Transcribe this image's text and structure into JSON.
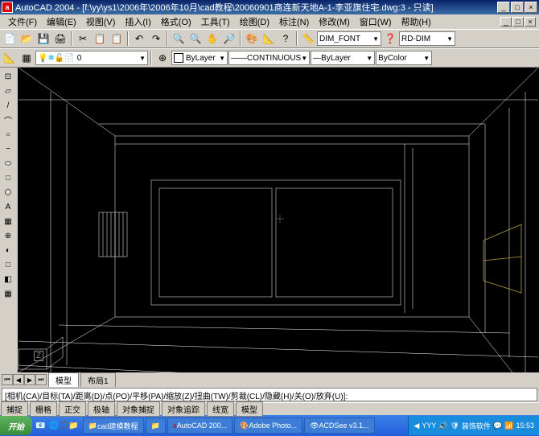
{
  "titlebar": {
    "app_icon_letter": "a",
    "title": "AutoCAD 2004 - [f:\\yy\\ys1\\2006年\\2006年10月\\cad教程\\20060901商连新天地A-1-李亚旗住宅.dwg:3 - 只读]",
    "min": "_",
    "max": "□",
    "close": "×"
  },
  "menubar": {
    "items": [
      "文件(F)",
      "编辑(E)",
      "视图(V)",
      "插入(I)",
      "格式(O)",
      "工具(T)",
      "绘图(D)",
      "标注(N)",
      "修改(M)",
      "窗口(W)",
      "帮助(H)"
    ]
  },
  "toolbar_row1": {
    "icons": [
      "📄",
      "📂",
      "💾",
      "🖨",
      "✂",
      "📋",
      "📋",
      "↶",
      "↷",
      "🔍",
      "🔍",
      "✋",
      "🔎",
      "🎨",
      "📐",
      "?",
      "📏",
      "❓"
    ],
    "dimfont": "DIM_FONT",
    "rddim": "RD-DIM"
  },
  "toolbar_row2": {
    "icons": [
      "📐",
      "▦",
      "⊕",
      "○",
      "◐",
      "⬚",
      "◧",
      "⬛",
      "📋"
    ],
    "layer": "ByLayer",
    "linetype": "CONTINUOUS",
    "lineweight": "ByLayer",
    "color": "ByColor"
  },
  "lefttools": {
    "icons": [
      "⊡",
      "▱",
      "/",
      "⌒",
      "○",
      "~",
      "⬭",
      "□",
      "⬡",
      "A",
      "▦",
      "⊕",
      "◐",
      "□",
      "◧",
      "▦"
    ]
  },
  "viewport": {
    "z_label": "Z"
  },
  "tabs": {
    "active": "模型",
    "inactive": "布局1"
  },
  "command": {
    "text": "[相机(CA)/目标(TA)/距离(D)/点(PO)/平移(PA)/缩放(Z)/扭曲(TW)/剪裁(CL)/隐藏(H)/关(O)/放弃(U)]:"
  },
  "statusbar": {
    "buttons": [
      "捕捉",
      "栅格",
      "正交",
      "极轴",
      "对象捕捉",
      "对象追踪",
      "线宽",
      "模型"
    ]
  },
  "taskbar": {
    "start": "开始",
    "quick": [
      "📧",
      "🌐",
      "🎵",
      "📁"
    ],
    "tasks": [
      "cad建模教程",
      "",
      "AutoCAD 200...",
      "Adobe Photo...",
      "ACDSee v3.1..."
    ],
    "tray_text": "YYY",
    "tray_text2": "装饰软件",
    "time": "15:53",
    "tray_icons": [
      "◀",
      "🔊",
      "🛡",
      "💬",
      "📶"
    ]
  }
}
